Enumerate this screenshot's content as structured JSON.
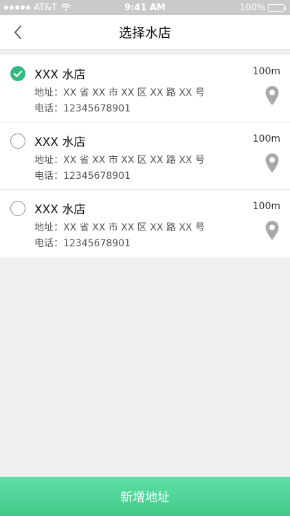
{
  "status_bar": {
    "carrier": "AT&T",
    "time": "9:41 AM",
    "battery": "100%"
  },
  "header": {
    "title": "选择水店"
  },
  "stores": [
    {
      "name": "XXX 水店",
      "address": "地址：XX 省 XX 市 XX 区 XX 路 XX 号",
      "phone": "电话：12345678901",
      "distance": "100m",
      "selected": true
    },
    {
      "name": "XXX 水店",
      "address": "地址：XX 省 XX 市 XX 区 XX 路 XX 号",
      "phone": "电话：12345678901",
      "distance": "100m",
      "selected": false
    },
    {
      "name": "XXX 水店",
      "address": "地址：XX 省 XX 市 XX 区 XX 路 XX 号",
      "phone": "电话：12345678901",
      "distance": "100m",
      "selected": false
    }
  ],
  "footer": {
    "add_label": "新增地址"
  },
  "icons": {
    "back": "chevron-left-icon",
    "location": "map-pin-icon",
    "selected": "check-circle-icon",
    "unselected": "radio-empty-icon"
  },
  "colors": {
    "accent": "#34b982",
    "button_gradient_top": "#5fe0a6",
    "button_gradient_bottom": "#41c989"
  }
}
